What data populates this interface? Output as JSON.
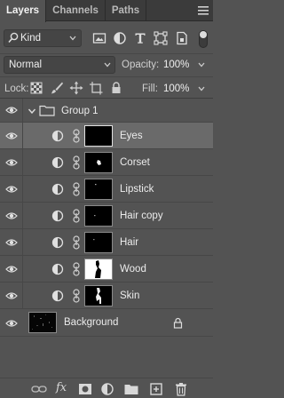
{
  "tabs": [
    {
      "label": "Layers",
      "active": true
    },
    {
      "label": "Channels",
      "active": false
    },
    {
      "label": "Paths",
      "active": false
    }
  ],
  "panel_menu_icon": "panel-menu-icon",
  "filter": {
    "kind_label": "Kind",
    "icons": [
      "pixel-filter-icon",
      "adjustment-filter-icon",
      "type-filter-icon",
      "shape-filter-icon",
      "smart-object-filter-icon"
    ]
  },
  "blend": {
    "mode": "Normal",
    "opacity_label": "Opacity:",
    "opacity_value": "100%"
  },
  "lock": {
    "label": "Lock:",
    "icons": [
      "lock-transparent-pixels-icon",
      "lock-image-pixels-icon",
      "lock-position-icon",
      "lock-artboard-icon",
      "lock-all-icon"
    ],
    "fill_label": "Fill:",
    "fill_value": "100%"
  },
  "layers": {
    "group": {
      "name": "Group 1",
      "expanded": true
    },
    "children": [
      {
        "name": "Eyes",
        "selected": true,
        "mask": "black"
      },
      {
        "name": "Corset",
        "selected": false,
        "mask": "corset"
      },
      {
        "name": "Lipstick",
        "selected": false,
        "mask": "dot"
      },
      {
        "name": "Hair copy",
        "selected": false,
        "mask": "dot"
      },
      {
        "name": "Hair",
        "selected": false,
        "mask": "dot"
      },
      {
        "name": "Wood",
        "selected": false,
        "mask": "wood"
      },
      {
        "name": "Skin",
        "selected": false,
        "mask": "skin"
      }
    ],
    "background": {
      "name": "Background",
      "locked": true
    }
  },
  "toolbar": {
    "icons": [
      "link-layers-icon",
      "fx-icon",
      "add-mask-icon",
      "new-adjustment-icon",
      "new-group-icon",
      "new-layer-icon",
      "delete-icon"
    ],
    "fx_label": "fx"
  },
  "colors": {
    "panel": "#535353",
    "tab_bar": "#3b3b3b",
    "selected_row": "#6a6a6a"
  }
}
